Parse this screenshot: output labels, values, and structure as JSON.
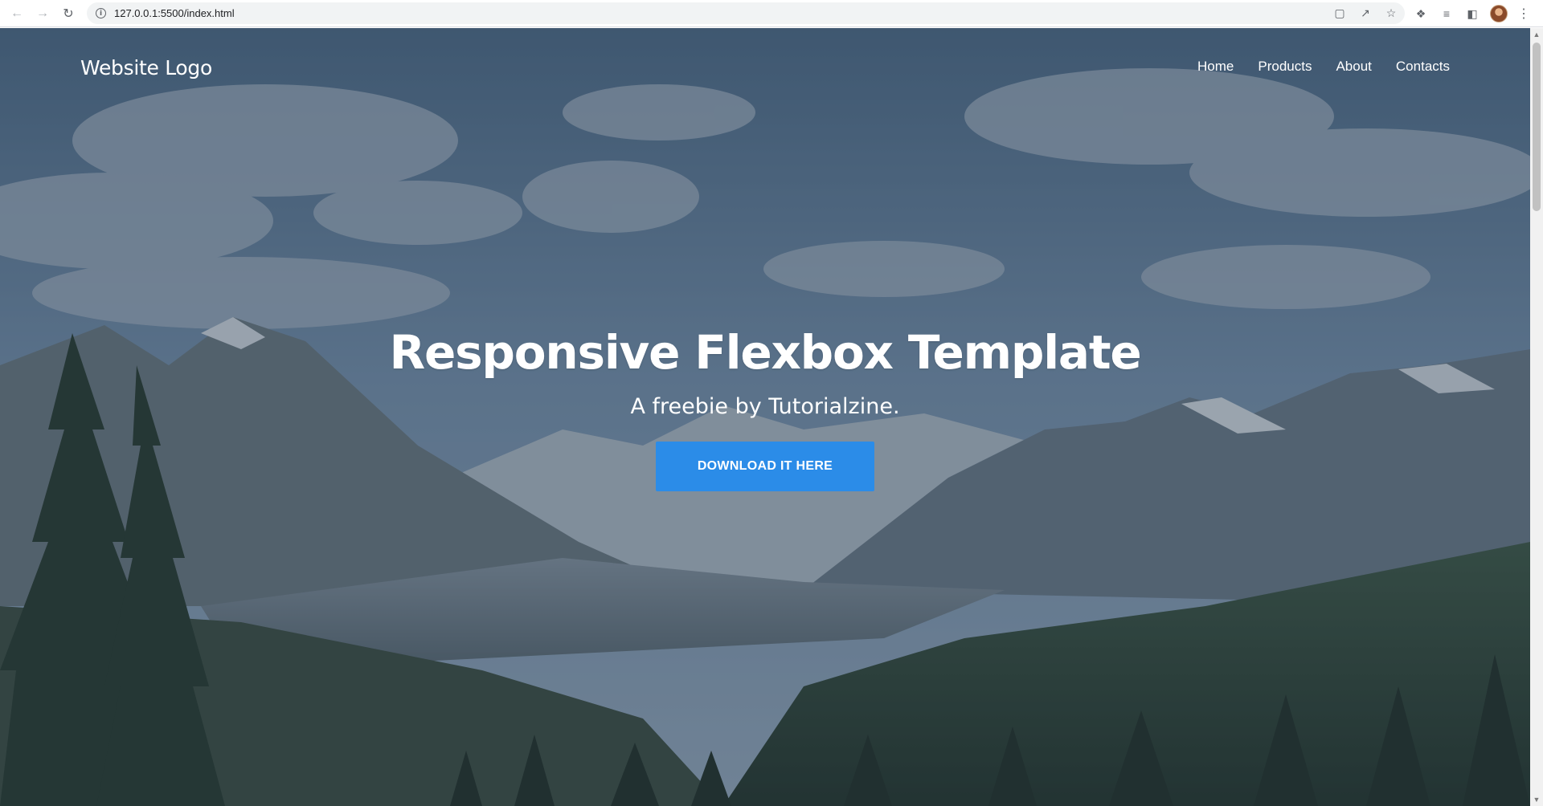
{
  "browser": {
    "url": "127.0.0.1:5500/index.html",
    "icons": {
      "back": "arrow-left-icon",
      "forward": "arrow-right-icon",
      "reload": "reload-icon",
      "site_info": "info-icon",
      "translate": "translate-icon",
      "share": "share-icon",
      "bookmark": "star-icon",
      "extensions": "puzzle-icon",
      "media": "media-queue-icon",
      "side_panel": "side-panel-icon",
      "menu": "kebab-menu-icon"
    }
  },
  "site": {
    "logo": "Website Logo",
    "nav": [
      {
        "label": "Home"
      },
      {
        "label": "Products"
      },
      {
        "label": "About"
      },
      {
        "label": "Contacts"
      }
    ]
  },
  "hero": {
    "title": "Responsive Flexbox Template",
    "subtitle": "A freebie by Tutorialzine.",
    "cta_label": "DOWNLOAD IT HERE"
  },
  "colors": {
    "cta_background": "#2b8ce8",
    "overlay": "rgba(38,52,70,0.38)",
    "text": "#ffffff"
  }
}
